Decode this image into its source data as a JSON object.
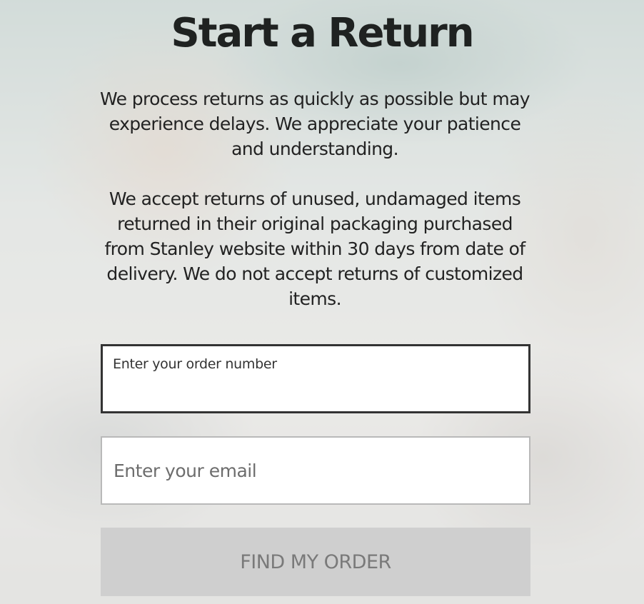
{
  "page": {
    "title": "Start a Return",
    "intro_paragraph": "We process returns as quickly as possible but may experience delays. We appreciate your patience and understanding.",
    "policy_paragraph": "We accept returns of unused, undamaged items returned in their original packaging purchased from Stanley website within 30 days from date of delivery. We do not accept returns of customized items."
  },
  "form": {
    "order_number": {
      "label": "Enter your order number",
      "value": ""
    },
    "email": {
      "placeholder": "Enter your email",
      "value": ""
    },
    "submit_label": "FIND MY ORDER"
  },
  "colors": {
    "title_text": "#1f2221",
    "active_border": "#333333",
    "inactive_border": "#b9b9b9",
    "button_bg": "#cdcdcd",
    "button_text": "#7a7a7a"
  }
}
